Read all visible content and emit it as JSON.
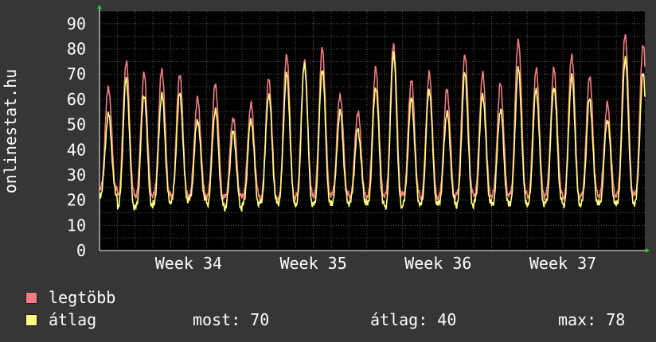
{
  "site_label": "onlinestat.hu",
  "legend": [
    {
      "name": "legtöbb",
      "color": "#f47c80"
    },
    {
      "name": "átlag",
      "color": "#ffff80"
    }
  ],
  "stats": {
    "most_label": "most:",
    "most_value": "70",
    "avg_label": "átlag:",
    "avg_value": "40",
    "max_label": "max:",
    "max_value": "78"
  },
  "colors": {
    "background": "#363636",
    "plot_bg": "#000000",
    "grid": "#555555",
    "grid_major": "#8a4848",
    "text": "#ffffff",
    "axis_arrow": "#22cc22"
  },
  "chart_data": {
    "type": "line",
    "ylim": [
      0,
      95
    ],
    "yticks": [
      0,
      10,
      20,
      30,
      40,
      50,
      60,
      70,
      80,
      90
    ],
    "x_unit": "days",
    "xlim": [
      0,
      30.6
    ],
    "xticks": [
      {
        "label": "Week 34",
        "x": 5.0
      },
      {
        "label": "Week 35",
        "x": 12.0
      },
      {
        "label": "Week 36",
        "x": 19.0
      },
      {
        "label": "Week 37",
        "x": 26.0
      }
    ],
    "grid": true,
    "legend_position": "bottom-left",
    "series": [
      {
        "name": "legtöbb",
        "color": "#f47c80",
        "daily_min": [
          24,
          22,
          22,
          22,
          21,
          22,
          21,
          21,
          22,
          20,
          20,
          22,
          22,
          22,
          21,
          22,
          22,
          22,
          21,
          21,
          22,
          22,
          22,
          22,
          21,
          23,
          20,
          22,
          22,
          22,
          22
        ],
        "daily_peak": [
          65,
          75,
          70,
          72,
          70,
          60,
          66,
          53,
          58,
          68,
          78,
          75,
          80,
          62,
          55,
          72,
          82,
          68,
          70,
          64,
          78,
          70,
          66,
          84,
          72,
          72,
          78,
          69,
          58,
          86,
          82
        ]
      },
      {
        "name": "átlag",
        "color": "#ffff80",
        "daily_min": [
          22,
          17,
          17,
          19,
          20,
          20,
          18,
          17,
          18,
          19,
          19,
          18,
          18,
          19,
          19,
          18,
          17,
          19,
          18,
          19,
          18,
          19,
          18,
          19,
          18,
          19,
          18,
          19,
          18,
          19,
          19
        ],
        "daily_peak": [
          54,
          68,
          62,
          62,
          62,
          52,
          56,
          47,
          52,
          62,
          70,
          74,
          72,
          55,
          48,
          65,
          78,
          60,
          64,
          55,
          70,
          62,
          56,
          72,
          64,
          65,
          69,
          60,
          52,
          76,
          70
        ]
      }
    ]
  }
}
